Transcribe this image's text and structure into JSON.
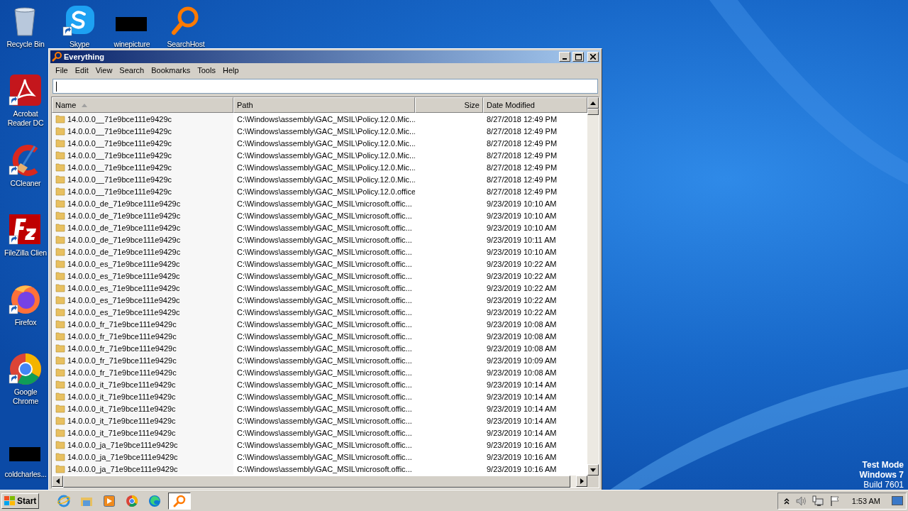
{
  "desktop_icons": [
    {
      "label": "Recycle Bin",
      "kind": "recycle",
      "shortcut": false
    },
    {
      "label": "Skype",
      "kind": "skype",
      "shortcut": true
    },
    {
      "label": "winepicture",
      "kind": "redacted",
      "shortcut": false
    },
    {
      "label": "SearchHost",
      "kind": "search",
      "shortcut": false
    },
    {
      "label": "Acrobat Reader DC",
      "kind": "acrobat",
      "shortcut": true
    },
    {
      "label": "CCleaner",
      "kind": "ccleaner",
      "shortcut": true
    },
    {
      "label": "FileZilla Clien",
      "kind": "filezilla",
      "shortcut": true
    },
    {
      "label": "Firefox",
      "kind": "firefox",
      "shortcut": true
    },
    {
      "label": "Google Chrome",
      "kind": "chrome",
      "shortcut": true
    },
    {
      "label": "coldcharles...",
      "kind": "redacted",
      "shortcut": false
    }
  ],
  "window": {
    "title": "Everything",
    "menu": [
      "File",
      "Edit",
      "View",
      "Search",
      "Bookmarks",
      "Tools",
      "Help"
    ],
    "table": {
      "columns": [
        {
          "label": "Name",
          "sorted": true
        },
        {
          "label": "Path",
          "sorted": false
        },
        {
          "label": "Size",
          "sorted": false
        },
        {
          "label": "Date Modified",
          "sorted": false
        }
      ],
      "rows": [
        {
          "name": "14.0.0.0__71e9bce111e9429c",
          "path": "C:\\Windows\\assembly\\GAC_MSIL\\Policy.12.0.Mic...",
          "date_modified": "8/27/2018 12:49 PM"
        },
        {
          "name": "14.0.0.0__71e9bce111e9429c",
          "path": "C:\\Windows\\assembly\\GAC_MSIL\\Policy.12.0.Mic...",
          "date_modified": "8/27/2018 12:49 PM"
        },
        {
          "name": "14.0.0.0__71e9bce111e9429c",
          "path": "C:\\Windows\\assembly\\GAC_MSIL\\Policy.12.0.Mic...",
          "date_modified": "8/27/2018 12:49 PM"
        },
        {
          "name": "14.0.0.0__71e9bce111e9429c",
          "path": "C:\\Windows\\assembly\\GAC_MSIL\\Policy.12.0.Mic...",
          "date_modified": "8/27/2018 12:49 PM"
        },
        {
          "name": "14.0.0.0__71e9bce111e9429c",
          "path": "C:\\Windows\\assembly\\GAC_MSIL\\Policy.12.0.Mic...",
          "date_modified": "8/27/2018 12:49 PM"
        },
        {
          "name": "14.0.0.0__71e9bce111e9429c",
          "path": "C:\\Windows\\assembly\\GAC_MSIL\\Policy.12.0.Mic...",
          "date_modified": "8/27/2018 12:49 PM"
        },
        {
          "name": "14.0.0.0__71e9bce111e9429c",
          "path": "C:\\Windows\\assembly\\GAC_MSIL\\Policy.12.0.office",
          "date_modified": "8/27/2018 12:49 PM"
        },
        {
          "name": "14.0.0.0_de_71e9bce111e9429c",
          "path": "C:\\Windows\\assembly\\GAC_MSIL\\microsoft.offic...",
          "date_modified": "9/23/2019 10:10 AM"
        },
        {
          "name": "14.0.0.0_de_71e9bce111e9429c",
          "path": "C:\\Windows\\assembly\\GAC_MSIL\\microsoft.offic...",
          "date_modified": "9/23/2019 10:10 AM"
        },
        {
          "name": "14.0.0.0_de_71e9bce111e9429c",
          "path": "C:\\Windows\\assembly\\GAC_MSIL\\microsoft.offic...",
          "date_modified": "9/23/2019 10:10 AM"
        },
        {
          "name": "14.0.0.0_de_71e9bce111e9429c",
          "path": "C:\\Windows\\assembly\\GAC_MSIL\\microsoft.offic...",
          "date_modified": "9/23/2019 10:11 AM"
        },
        {
          "name": "14.0.0.0_de_71e9bce111e9429c",
          "path": "C:\\Windows\\assembly\\GAC_MSIL\\microsoft.offic...",
          "date_modified": "9/23/2019 10:10 AM"
        },
        {
          "name": "14.0.0.0_es_71e9bce111e9429c",
          "path": "C:\\Windows\\assembly\\GAC_MSIL\\microsoft.offic...",
          "date_modified": "9/23/2019 10:22 AM"
        },
        {
          "name": "14.0.0.0_es_71e9bce111e9429c",
          "path": "C:\\Windows\\assembly\\GAC_MSIL\\microsoft.offic...",
          "date_modified": "9/23/2019 10:22 AM"
        },
        {
          "name": "14.0.0.0_es_71e9bce111e9429c",
          "path": "C:\\Windows\\assembly\\GAC_MSIL\\microsoft.offic...",
          "date_modified": "9/23/2019 10:22 AM"
        },
        {
          "name": "14.0.0.0_es_71e9bce111e9429c",
          "path": "C:\\Windows\\assembly\\GAC_MSIL\\microsoft.offic...",
          "date_modified": "9/23/2019 10:22 AM"
        },
        {
          "name": "14.0.0.0_es_71e9bce111e9429c",
          "path": "C:\\Windows\\assembly\\GAC_MSIL\\microsoft.offic...",
          "date_modified": "9/23/2019 10:22 AM"
        },
        {
          "name": "14.0.0.0_fr_71e9bce111e9429c",
          "path": "C:\\Windows\\assembly\\GAC_MSIL\\microsoft.offic...",
          "date_modified": "9/23/2019 10:08 AM"
        },
        {
          "name": "14.0.0.0_fr_71e9bce111e9429c",
          "path": "C:\\Windows\\assembly\\GAC_MSIL\\microsoft.offic...",
          "date_modified": "9/23/2019 10:08 AM"
        },
        {
          "name": "14.0.0.0_fr_71e9bce111e9429c",
          "path": "C:\\Windows\\assembly\\GAC_MSIL\\microsoft.offic...",
          "date_modified": "9/23/2019 10:08 AM"
        },
        {
          "name": "14.0.0.0_fr_71e9bce111e9429c",
          "path": "C:\\Windows\\assembly\\GAC_MSIL\\microsoft.offic...",
          "date_modified": "9/23/2019 10:09 AM"
        },
        {
          "name": "14.0.0.0_fr_71e9bce111e9429c",
          "path": "C:\\Windows\\assembly\\GAC_MSIL\\microsoft.offic...",
          "date_modified": "9/23/2019 10:08 AM"
        },
        {
          "name": "14.0.0.0_it_71e9bce111e9429c",
          "path": "C:\\Windows\\assembly\\GAC_MSIL\\microsoft.offic...",
          "date_modified": "9/23/2019 10:14 AM"
        },
        {
          "name": "14.0.0.0_it_71e9bce111e9429c",
          "path": "C:\\Windows\\assembly\\GAC_MSIL\\microsoft.offic...",
          "date_modified": "9/23/2019 10:14 AM"
        },
        {
          "name": "14.0.0.0_it_71e9bce111e9429c",
          "path": "C:\\Windows\\assembly\\GAC_MSIL\\microsoft.offic...",
          "date_modified": "9/23/2019 10:14 AM"
        },
        {
          "name": "14.0.0.0_it_71e9bce111e9429c",
          "path": "C:\\Windows\\assembly\\GAC_MSIL\\microsoft.offic...",
          "date_modified": "9/23/2019 10:14 AM"
        },
        {
          "name": "14.0.0.0_it_71e9bce111e9429c",
          "path": "C:\\Windows\\assembly\\GAC_MSIL\\microsoft.offic...",
          "date_modified": "9/23/2019 10:14 AM"
        },
        {
          "name": "14.0.0.0_ja_71e9bce111e9429c",
          "path": "C:\\Windows\\assembly\\GAC_MSIL\\microsoft.offic...",
          "date_modified": "9/23/2019 10:16 AM"
        },
        {
          "name": "14.0.0.0_ja_71e9bce111e9429c",
          "path": "C:\\Windows\\assembly\\GAC_MSIL\\microsoft.offic...",
          "date_modified": "9/23/2019 10:16 AM"
        },
        {
          "name": "14.0.0.0_ja_71e9bce111e9429c",
          "path": "C:\\Windows\\assembly\\GAC_MSIL\\microsoft.offic...",
          "date_modified": "9/23/2019 10:16 AM"
        }
      ]
    }
  },
  "os_notice": [
    "Test Mode",
    "Windows 7",
    "Build 7601"
  ],
  "taskbar": {
    "start": "Start",
    "apps": [
      {
        "kind": "ie",
        "selected": false
      },
      {
        "kind": "explorer",
        "selected": false
      },
      {
        "kind": "media",
        "selected": false
      },
      {
        "kind": "chrome",
        "selected": false
      },
      {
        "kind": "edge",
        "selected": false
      },
      {
        "kind": "search",
        "selected": true
      }
    ],
    "clock": "1:53 AM"
  }
}
